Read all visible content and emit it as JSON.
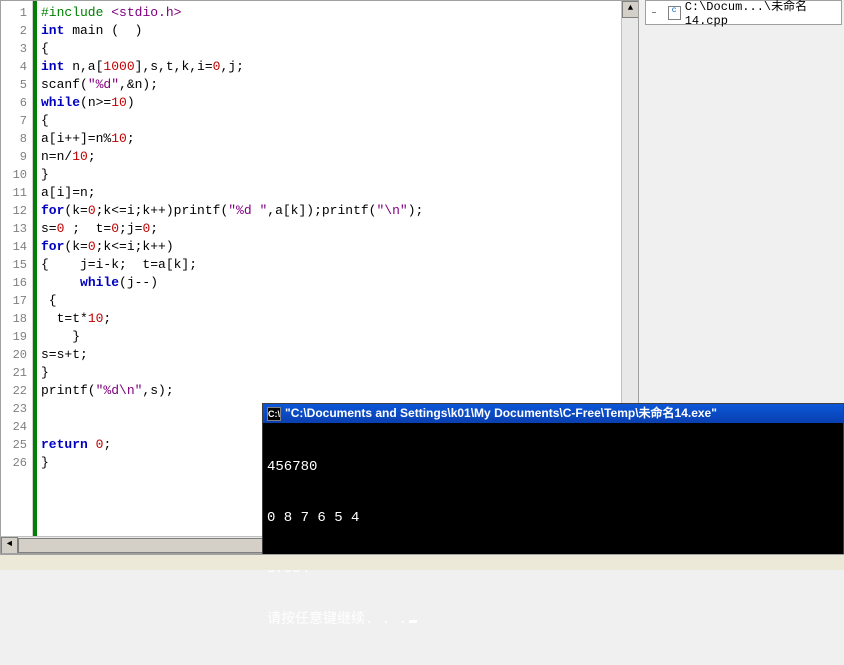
{
  "code_lines": [
    {
      "n": "1",
      "html": "<span class='pp'>#include</span> <span class='inc'>&lt;stdio.h&gt;</span>"
    },
    {
      "n": "2",
      "html": "<span class='kw'>int</span> main (  )"
    },
    {
      "n": "3",
      "html": "{"
    },
    {
      "n": "4",
      "html": "<span class='kw'>int</span> n,a[<span class='num'>1000</span>],s,t,k,i=<span class='num'>0</span>,j;"
    },
    {
      "n": "5",
      "html": "scanf(<span class='str'>\"%d\"</span>,&amp;n);"
    },
    {
      "n": "6",
      "html": "<span class='kw'>while</span>(n&gt;=<span class='num'>10</span>)"
    },
    {
      "n": "7",
      "html": "{"
    },
    {
      "n": "8",
      "html": "a[i++]=n%<span class='num'>10</span>;"
    },
    {
      "n": "9",
      "html": "n=n/<span class='num'>10</span>;"
    },
    {
      "n": "10",
      "html": "}"
    },
    {
      "n": "11",
      "html": "a[i]=n;"
    },
    {
      "n": "12",
      "html": "<span class='kw'>for</span>(k=<span class='num'>0</span>;k&lt;=i;k++)printf(<span class='str'>\"%d \"</span>,a[k]);printf(<span class='str'>\"\\n\"</span>);"
    },
    {
      "n": "13",
      "html": "s=<span class='num'>0</span> ;  t=<span class='num'>0</span>;j=<span class='num'>0</span>;"
    },
    {
      "n": "14",
      "html": "<span class='kw'>for</span>(k=<span class='num'>0</span>;k&lt;=i;k++)"
    },
    {
      "n": "15",
      "html": "{    j=i-k;  t=a[k];"
    },
    {
      "n": "16",
      "html": "     <span class='kw'>while</span>(j--)"
    },
    {
      "n": "17",
      "html": " {"
    },
    {
      "n": "18",
      "html": "  t=t*<span class='num'>10</span>;"
    },
    {
      "n": "19",
      "html": "    }"
    },
    {
      "n": "20",
      "html": "s=s+t;"
    },
    {
      "n": "21",
      "html": "}"
    },
    {
      "n": "22",
      "html": "printf(<span class='str'>\"%d\\n\"</span>,s);"
    },
    {
      "n": "23",
      "html": ""
    },
    {
      "n": "24",
      "html": ""
    },
    {
      "n": "25",
      "html": "<span class='kw'>return</span> <span class='num'>0</span>;"
    },
    {
      "n": "26",
      "html": "}"
    }
  ],
  "file_tree": {
    "path": "C:\\Docum...\\未命名14.cpp"
  },
  "console": {
    "sysicon_glyph": "C:\\",
    "title": "\"C:\\Documents and Settings\\k01\\My Documents\\C-Free\\Temp\\未命名14.exe\"",
    "lines": [
      "456780",
      "0 8 7 6 5 4",
      "87654",
      "请按任意键继续. . ."
    ]
  }
}
